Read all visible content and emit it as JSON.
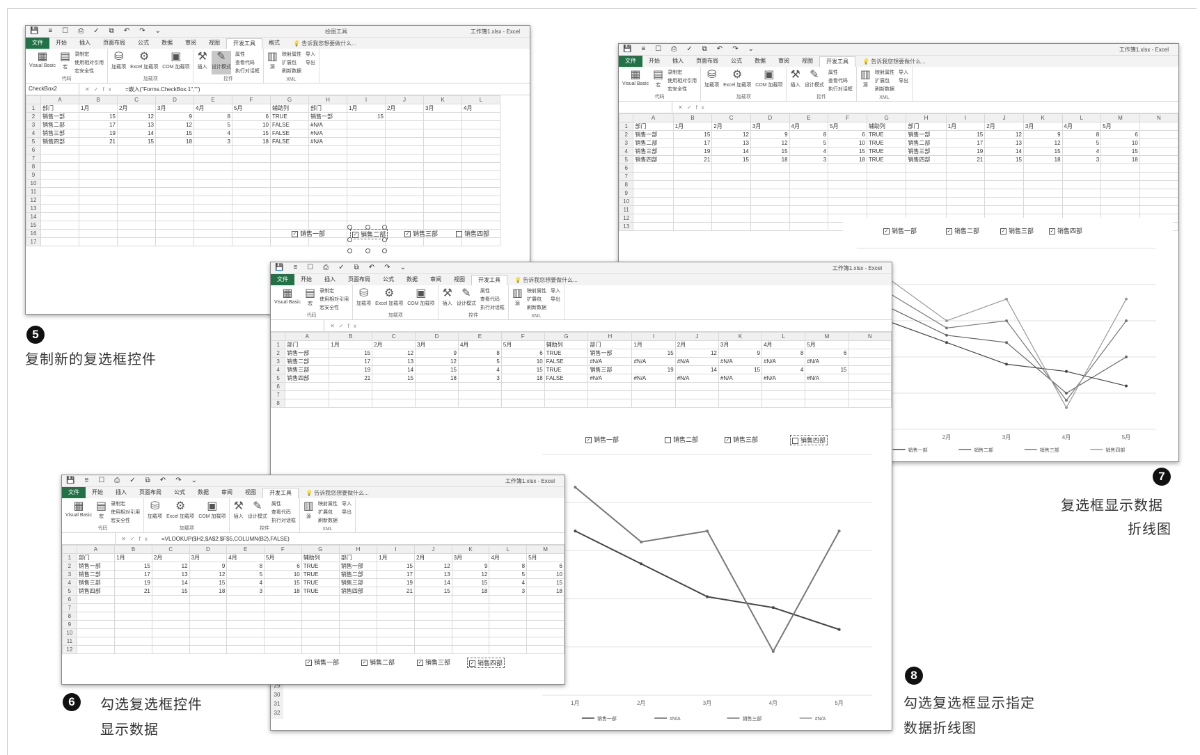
{
  "common": {
    "title": "工作簿1.xlsx - Excel",
    "tabs": [
      "文件",
      "开始",
      "插入",
      "页面布局",
      "公式",
      "数据",
      "审阅",
      "视图",
      "开发工具",
      "格式"
    ],
    "tell_me": "告诉我您想要做什么...",
    "context_tab": "绘图工具",
    "ribbon": {
      "code": {
        "vb": "Visual Basic",
        "macro": "宏",
        "record": "录制宏",
        "relative": "使用相对引用",
        "security": "宏安全性",
        "label": "代码"
      },
      "addins": {
        "addin": "加载项",
        "excel": "Excel 加载项",
        "com": "COM 加载项",
        "label": "加载项"
      },
      "controls": {
        "insert": "插入",
        "design": "设计模式",
        "props": "属性",
        "viewcode": "查看代码",
        "dialog": "执行对话框",
        "label": "控件"
      },
      "xml": {
        "source": "源",
        "map": "映射属性",
        "ext": "扩展包",
        "refresh": "刷新数据",
        "import": "导入",
        "export": "导出",
        "label": "XML"
      }
    },
    "col_headers": [
      "A",
      "B",
      "C",
      "D",
      "E",
      "F",
      "G",
      "H",
      "I",
      "J",
      "K",
      "L",
      "M",
      "N"
    ],
    "header_row": [
      "部门",
      "1月",
      "2月",
      "3月",
      "4月",
      "5月",
      "辅助列",
      "部门",
      "1月",
      "2月",
      "3月",
      "4月",
      "5月"
    ]
  },
  "win5": {
    "namebox": "CheckBox2",
    "formula": "=嵌入(\"Forms.CheckBox.1\",\"\")",
    "rows": [
      [
        "销售一部",
        "15",
        "12",
        "9",
        "8",
        "6",
        "TRUE",
        "销售一部",
        "15",
        "",
        "",
        "",
        ""
      ],
      [
        "销售二部",
        "17",
        "13",
        "12",
        "5",
        "10",
        "FALSE",
        "#N/A",
        "",
        "",
        "",
        "",
        ""
      ],
      [
        "销售三部",
        "19",
        "14",
        "15",
        "4",
        "15",
        "FALSE",
        "#N/A",
        "",
        "",
        "",
        "",
        ""
      ],
      [
        "销售四部",
        "21",
        "15",
        "18",
        "3",
        "18",
        "FALSE",
        "#N/A",
        "",
        "",
        "",
        "",
        ""
      ]
    ],
    "row_numbers": [
      "1",
      "2",
      "3",
      "4",
      "5",
      "6",
      "7",
      "8",
      "9",
      "10",
      "11",
      "12",
      "13",
      "14",
      "15",
      "16",
      "17"
    ],
    "checkboxes": [
      {
        "label": "销售一部",
        "checked": true
      },
      {
        "label": "销售二部",
        "checked": true
      },
      {
        "label": "销售三部",
        "checked": true
      },
      {
        "label": "销售四部",
        "checked": false
      }
    ],
    "caption": "复制新的复选框控件",
    "badge": "5"
  },
  "win7": {
    "rows": [
      [
        "销售一部",
        "15",
        "12",
        "9",
        "8",
        "6",
        "TRUE",
        "销售一部",
        "15",
        "12",
        "9",
        "8",
        "6"
      ],
      [
        "销售二部",
        "17",
        "13",
        "12",
        "5",
        "10",
        "TRUE",
        "销售二部",
        "17",
        "13",
        "12",
        "5",
        "10"
      ],
      [
        "销售三部",
        "19",
        "14",
        "15",
        "4",
        "15",
        "TRUE",
        "销售三部",
        "19",
        "14",
        "15",
        "4",
        "15"
      ],
      [
        "销售四部",
        "21",
        "15",
        "18",
        "3",
        "18",
        "TRUE",
        "销售四部",
        "21",
        "15",
        "18",
        "3",
        "18"
      ]
    ],
    "row_numbers": [
      "1",
      "2",
      "3",
      "4",
      "5",
      "6",
      "7",
      "8",
      "9",
      "10",
      "11",
      "12",
      "13"
    ],
    "checkboxes": [
      {
        "label": "销售一部",
        "checked": true
      },
      {
        "label": "销售二部",
        "checked": true
      },
      {
        "label": "销售三部",
        "checked": true
      },
      {
        "label": "销售四部",
        "checked": true
      }
    ],
    "caption_lines": [
      "复选框显示数据",
      "折线图"
    ],
    "badge": "7"
  },
  "win8": {
    "rows": [
      [
        "销售一部",
        "15",
        "12",
        "9",
        "8",
        "6",
        "TRUE",
        "销售一部",
        "15",
        "12",
        "9",
        "8",
        "6"
      ],
      [
        "销售二部",
        "17",
        "13",
        "12",
        "5",
        "10",
        "FALSE",
        "#N/A",
        "#N/A",
        "#N/A",
        "#N/A",
        "#N/A",
        "#N/A"
      ],
      [
        "销售三部",
        "19",
        "14",
        "15",
        "4",
        "15",
        "TRUE",
        "销售三部",
        "19",
        "14",
        "15",
        "4",
        "15"
      ],
      [
        "销售四部",
        "21",
        "15",
        "18",
        "3",
        "18",
        "FALSE",
        "#N/A",
        "#N/A",
        "#N/A",
        "#N/A",
        "#N/A",
        "#N/A"
      ]
    ],
    "row_numbers": [
      "1",
      "2",
      "3",
      "4",
      "5",
      "6",
      "7",
      "8"
    ],
    "bottom_row_numbers": [
      "29",
      "30",
      "31",
      "32"
    ],
    "checkboxes": [
      {
        "label": "销售一部",
        "checked": true
      },
      {
        "label": "销售二部",
        "checked": false
      },
      {
        "label": "销售三部",
        "checked": true
      },
      {
        "label": "销售四部",
        "checked": false
      }
    ],
    "caption_lines": [
      "勾选复选框显示指定",
      "数据折线图"
    ],
    "badge": "8"
  },
  "win6": {
    "formula": "=VLOOKUP($H2,$A$2:$F$5,COLUMN(B2),FALSE)",
    "rows": [
      [
        "销售一部",
        "15",
        "12",
        "9",
        "8",
        "6",
        "TRUE",
        "销售一部",
        "15",
        "12",
        "9",
        "8",
        "6"
      ],
      [
        "销售二部",
        "17",
        "13",
        "12",
        "5",
        "10",
        "TRUE",
        "销售二部",
        "17",
        "13",
        "12",
        "5",
        "10"
      ],
      [
        "销售三部",
        "19",
        "14",
        "15",
        "4",
        "15",
        "TRUE",
        "销售三部",
        "19",
        "14",
        "15",
        "4",
        "15"
      ],
      [
        "销售四部",
        "21",
        "15",
        "18",
        "3",
        "18",
        "TRUE",
        "销售四部",
        "21",
        "15",
        "18",
        "3",
        "18"
      ]
    ],
    "row_numbers": [
      "1",
      "2",
      "3",
      "4",
      "5",
      "6",
      "7",
      "8",
      "9",
      "10",
      "11",
      "12"
    ],
    "checkboxes": [
      {
        "label": "销售一部",
        "checked": true
      },
      {
        "label": "销售二部",
        "checked": true
      },
      {
        "label": "销售三部",
        "checked": true
      },
      {
        "label": "销售四部",
        "checked": true
      }
    ],
    "caption_lines": [
      "勾选复选框控件",
      "显示数据"
    ],
    "badge": "6"
  },
  "chart_data": [
    {
      "type": "line",
      "categories": [
        "1月",
        "2月",
        "3月",
        "4月",
        "5月"
      ],
      "series": [
        {
          "name": "销售一部",
          "values": [
            15,
            12,
            9,
            8,
            6
          ]
        },
        {
          "name": "销售二部",
          "values": [
            17,
            13,
            12,
            5,
            10
          ]
        },
        {
          "name": "销售三部",
          "values": [
            19,
            14,
            15,
            4,
            15
          ]
        },
        {
          "name": "销售四部",
          "values": [
            21,
            15,
            18,
            3,
            18
          ]
        }
      ],
      "ylim": [
        0,
        25
      ],
      "legend": "bottom",
      "grid": true,
      "color": "#555555"
    },
    {
      "type": "line",
      "categories": [
        "1月",
        "2月",
        "3月",
        "4月",
        "5月"
      ],
      "series": [
        {
          "name": "销售一部",
          "values": [
            15,
            12,
            9,
            8,
            6
          ]
        },
        {
          "name": "#N/A",
          "values": [
            null,
            null,
            null,
            null,
            null
          ]
        },
        {
          "name": "销售三部",
          "values": [
            19,
            14,
            15,
            4,
            15
          ]
        },
        {
          "name": "#N/A",
          "values": [
            null,
            null,
            null,
            null,
            null
          ]
        }
      ],
      "ylim": [
        0,
        22
      ],
      "legend": "bottom",
      "grid": true,
      "color": "#555555"
    }
  ]
}
